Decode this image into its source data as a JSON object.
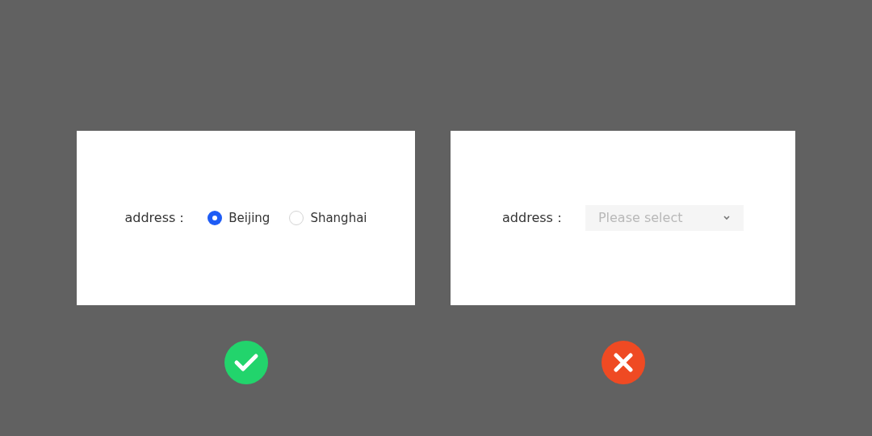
{
  "examples": [
    {
      "kind": "radio",
      "label": "address：",
      "options": [
        {
          "label": "Beijing",
          "selected": true
        },
        {
          "label": "Shanghai",
          "selected": false
        }
      ],
      "correct": true
    },
    {
      "kind": "select",
      "label": "address：",
      "placeholder": "Please select",
      "correct": false
    }
  ]
}
